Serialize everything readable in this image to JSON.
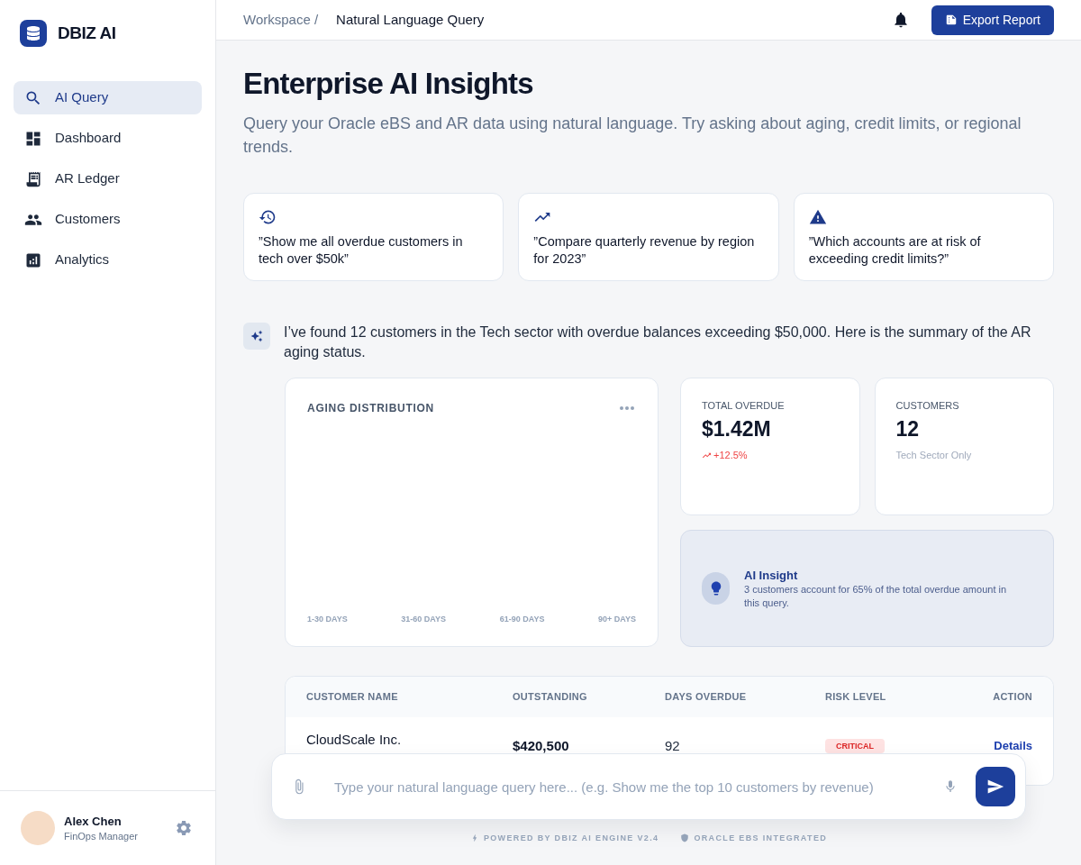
{
  "sidebar": {
    "brand": "DBIZ AI",
    "items": [
      {
        "label": "AI Query",
        "selected": true
      },
      {
        "label": "Dashboard",
        "selected": false
      },
      {
        "label": "AR Ledger",
        "selected": false
      },
      {
        "label": "Customers",
        "selected": false
      },
      {
        "label": "Analytics",
        "selected": false
      }
    ],
    "user": {
      "name": "Alex Chen",
      "role": "FinOps Manager"
    }
  },
  "header": {
    "breadcrumb": [
      "Workspace /",
      "Natural Language Query"
    ],
    "export_button": "Export Report"
  },
  "page": {
    "title": "Enterprise AI Insights",
    "subtitle": "Query your Oracle eBS and AR data using natural language. Try asking about aging, credit limits, or regional trends."
  },
  "suggestions": [
    "”Show me all overdue customers in tech over $50k”",
    "”Compare quarterly revenue by region for 2023”",
    "”Which accounts are at risk of exceeding credit limits?”"
  ],
  "response": {
    "text": "I’ve found 12 customers in the Tech sector with overdue balances exceeding $50,000. Here is the summary of the AR aging status."
  },
  "chart": {
    "title": "AGING DISTRIBUTION",
    "x_labels": [
      "1-30 DAYS",
      "31-60 DAYS",
      "61-90 DAYS",
      "90+ DAYS"
    ]
  },
  "stats": [
    {
      "label": "TOTAL OVERDUE",
      "value": "$1.42M",
      "change": "+12.5%"
    },
    {
      "label": "CUSTOMERS",
      "value": "12",
      "note": "Tech Sector Only"
    }
  ],
  "insight": {
    "title": "AI Insight",
    "text": "3 customers account for 65% of the total overdue amount in this query."
  },
  "table": {
    "columns": [
      "CUSTOMER NAME",
      "OUTSTANDING",
      "DAYS OVERDUE",
      "RISK LEVEL",
      "ACTION"
    ],
    "rows": [
      {
        "customer": "CloudScale Inc.",
        "outstanding": "$420,500",
        "days_overdue": "92",
        "risk": {
          "label": "CRITICAL",
          "kind": "critical"
        },
        "action": "Details"
      }
    ]
  },
  "composer": {
    "placeholder": "Type your natural language query here... (e.g. Show me the top 10 customers by revenue)"
  },
  "footer": [
    "POWERED BY DBIZ AI ENGINE V2.4",
    "ORACLE EBS INTEGRATED"
  ]
}
